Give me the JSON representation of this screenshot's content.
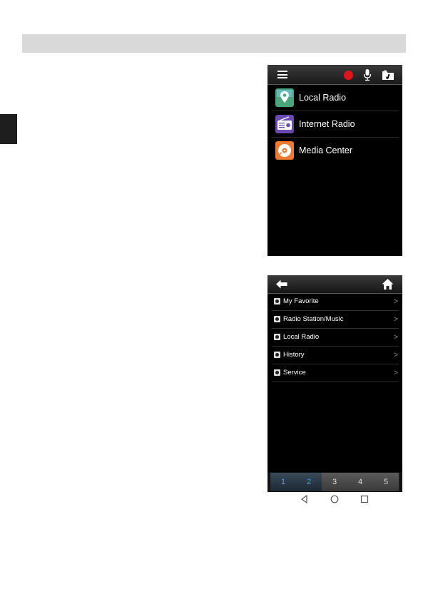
{
  "screen1": {
    "header_icons": [
      "menu-icon",
      "record-icon",
      "microphone-icon",
      "music-folder-icon"
    ],
    "items": [
      {
        "label": "Local Radio",
        "icon": "map-pin-icon",
        "color": "#4aa57a"
      },
      {
        "label": "Internet Radio",
        "icon": "radio-icon",
        "color": "#6a4ab0"
      },
      {
        "label": "Media Center",
        "icon": "disc-icon",
        "color": "#f07a30"
      }
    ]
  },
  "screen2": {
    "header_icons": [
      "back-arrow-icon",
      "home-icon"
    ],
    "items": [
      {
        "label": "My Favorite",
        "icon": "heart-icon"
      },
      {
        "label": "Radio Station/Music",
        "icon": "music-note-icon"
      },
      {
        "label": "Local Radio",
        "icon": "pin-icon"
      },
      {
        "label": "History",
        "icon": "clock-icon"
      },
      {
        "label": "Service",
        "icon": "service-icon"
      }
    ],
    "chevron": ">",
    "presets": [
      "1",
      "2",
      "3",
      "4",
      "5"
    ],
    "accent": "#37a8e6"
  }
}
